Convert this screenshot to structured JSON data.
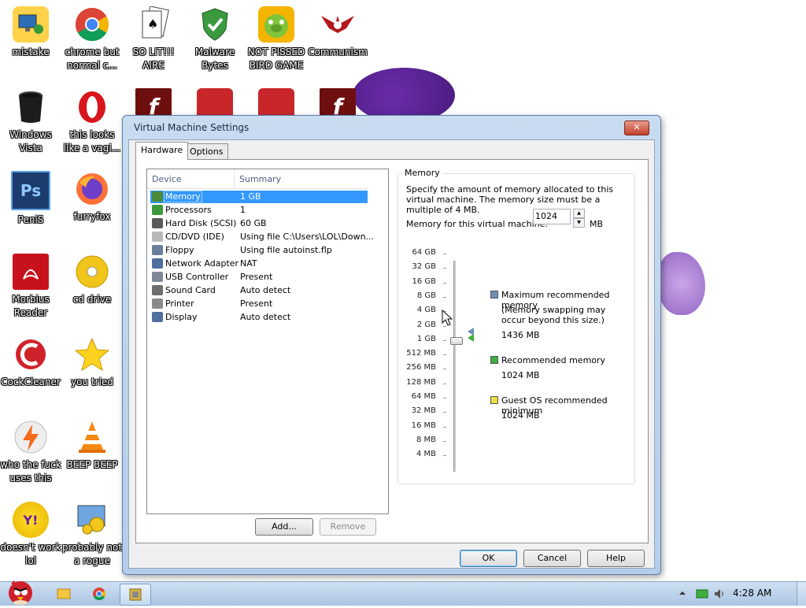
{
  "desktop": {
    "icons": [
      {
        "label": "mistake"
      },
      {
        "label": "chrome but normal c..."
      },
      {
        "label": "SO LIT!!! AIRE"
      },
      {
        "label": "Malware Bytes"
      },
      {
        "label": "NOT PISSED BIRD GAME"
      },
      {
        "label": "Communism"
      },
      {
        "label": "Windows Vista"
      },
      {
        "label": "this looks like a vagi..."
      },
      {
        "label": "PeniS",
        "glyph": "Ps"
      },
      {
        "label": "furryfox"
      },
      {
        "label": "Morbius Reader"
      },
      {
        "label": "cd drive"
      },
      {
        "label": "CockCleaner"
      },
      {
        "label": "you tried"
      },
      {
        "label": "who the fuck uses this"
      },
      {
        "label": "BEEP BEEP"
      },
      {
        "label": "doesn't work lol",
        "glyph": "Y!"
      },
      {
        "label": "probably not a rogue"
      }
    ]
  },
  "dialog": {
    "title": "Virtual Machine Settings",
    "close_glyph": "✕",
    "tabs": [
      {
        "label": "Hardware",
        "active": true
      },
      {
        "label": "Options",
        "active": false
      }
    ],
    "device_list": {
      "headers": {
        "device": "Device",
        "summary": "Summary"
      },
      "rows": [
        {
          "device": "Memory",
          "summary": "1 GB",
          "icon": "memory-icon",
          "color": "#4a8a3a",
          "selected": true
        },
        {
          "device": "Processors",
          "summary": "1",
          "icon": "processor-icon",
          "color": "#3c9a3c"
        },
        {
          "device": "Hard Disk (SCSI)",
          "summary": "60 GB",
          "icon": "hard-disk-icon",
          "color": "#5a5a5a"
        },
        {
          "device": "CD/DVD (IDE)",
          "summary": "Using file C:\\Users\\LOL\\Down...",
          "icon": "cd-dvd-icon",
          "color": "#b8b8b8"
        },
        {
          "device": "Floppy",
          "summary": "Using file autoinst.flp",
          "icon": "floppy-icon",
          "color": "#6a7d9a"
        },
        {
          "device": "Network Adapter",
          "summary": "NAT",
          "icon": "network-adapter-icon",
          "color": "#4e6e9e"
        },
        {
          "device": "USB Controller",
          "summary": "Present",
          "icon": "usb-controller-icon",
          "color": "#7d8795"
        },
        {
          "device": "Sound Card",
          "summary": "Auto detect",
          "icon": "sound-card-icon",
          "color": "#6e6e6e"
        },
        {
          "device": "Printer",
          "summary": "Present",
          "icon": "printer-icon",
          "color": "#8a8a8a"
        },
        {
          "device": "Display",
          "summary": "Auto detect",
          "icon": "display-icon",
          "color": "#4f6f9f"
        }
      ]
    },
    "add_button": "Add...",
    "remove_button": "Remove",
    "memory": {
      "group_label": "Memory",
      "description": "Specify the amount of memory allocated to this virtual machine. The memory size must be a multiple of 4 MB.",
      "field_label": "Memory for this virtual machine:",
      "value": "1024",
      "unit": "MB",
      "scale_labels": [
        "64 GB",
        "32 GB",
        "16 GB",
        "8 GB",
        "4 GB",
        "2 GB",
        "1 GB",
        "512 MB",
        "256 MB",
        "128 MB",
        "64 MB",
        "32 MB",
        "16 MB",
        "8 MB",
        "4 MB"
      ],
      "slider_value": "1 GB",
      "legend": [
        {
          "title": "Maximum recommended memory",
          "note": "(Memory swapping may occur beyond this size.)",
          "value": "1436 MB",
          "color": "#6f8fb8"
        },
        {
          "title": "Recommended memory",
          "value": "1024 MB",
          "color": "#3fb03f"
        },
        {
          "title": "Guest OS recommended minimum",
          "value": "1024 MB",
          "color": "#e6e040"
        }
      ]
    },
    "ok_button": "OK",
    "cancel_button": "Cancel",
    "help_button": "Help"
  },
  "taskbar": {
    "clock": "4:28 AM",
    "items": [
      "angry-bird-start-icon",
      "explorer-icon",
      "chrome-icon",
      "vmware-icon"
    ]
  }
}
